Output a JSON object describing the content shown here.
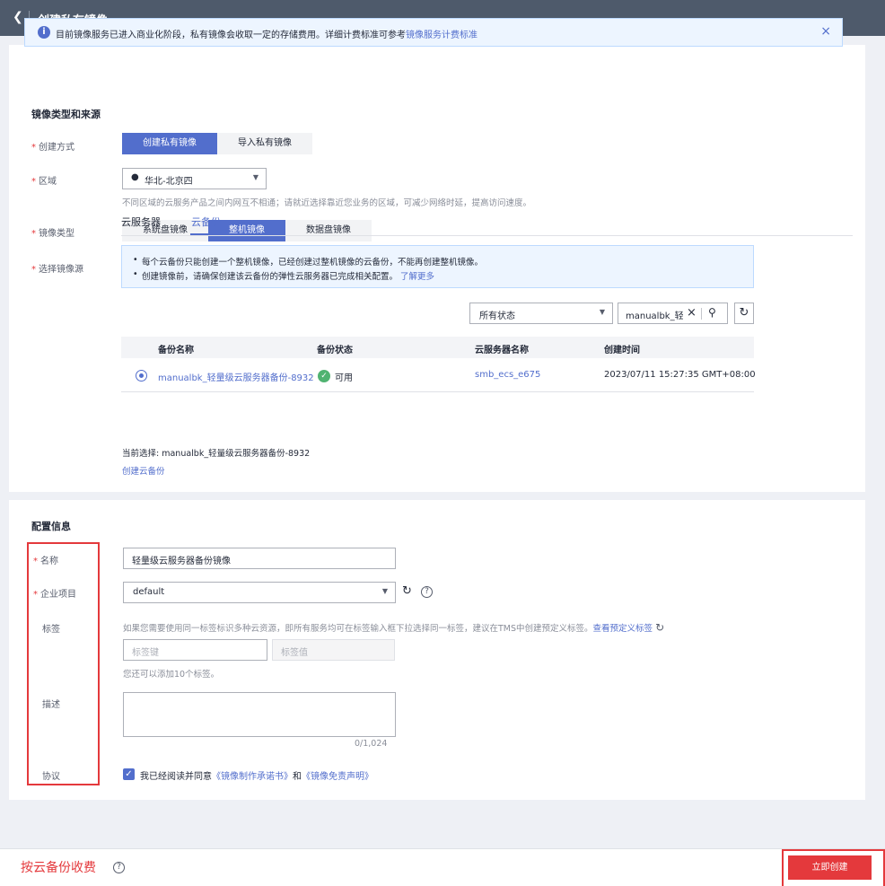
{
  "header": {
    "title": "创建私有镜像",
    "back_icon": "chevron-left-icon"
  },
  "notice": {
    "text": "目前镜像服务已进入商业化阶段，私有镜像会收取一定的存储费用。详细计费标准可参考",
    "link": "镜像服务计费标准",
    "close": "×"
  },
  "section1": {
    "title": "镜像类型和来源"
  },
  "create_method": {
    "label": "创建方式",
    "options": [
      "创建私有镜像",
      "导入私有镜像"
    ],
    "selected": "创建私有镜像"
  },
  "region": {
    "label": "区域",
    "value": "华北-北京四",
    "hint": "不同区域的云服务产品之间内网互不相通；请就近选择靠近您业务的区域，可减少网络时延，提高访问速度。"
  },
  "image_type": {
    "label": "镜像类型",
    "options": [
      "系统盘镜像",
      "整机镜像",
      "数据盘镜像"
    ],
    "selected": "整机镜像"
  },
  "image_source": {
    "label": "选择镜像源",
    "tabs": [
      "云服务器",
      "云备份"
    ],
    "active_tab": "云备份"
  },
  "tips": {
    "line1": "每个云备份只能创建一个整机镜像，已经创建过整机镜像的云备份，不能再创建整机镜像。",
    "line2": "创建镜像前，请确保创建该云备份的弹性云服务器已完成相关配置。",
    "line2_link": "了解更多"
  },
  "filter": {
    "status": "所有状态",
    "search_value": "manualbk_轻量级"
  },
  "table": {
    "headers": [
      "备份名称",
      "备份状态",
      "云服务器名称",
      "创建时间"
    ],
    "rows": [
      {
        "name": "manualbk_轻量级云服务器备份-8932",
        "status": "可用",
        "server": "smb_ecs_e675",
        "created": "2023/07/11 15:27:35 GMT+08:00"
      }
    ]
  },
  "current_selection": "当前选择: manualbk_轻量级云服务器备份-8932",
  "create_backup_link": "创建云备份",
  "section2": {
    "title": "配置信息"
  },
  "name_field": {
    "label": "名称",
    "value": "轻量级云服务器备份镜像"
  },
  "project": {
    "label": "企业项目",
    "value": "default"
  },
  "tags": {
    "label": "标签",
    "hint": "如果您需要使用同一标签标识多种云资源，即所有服务均可在标签输入框下拉选择同一标签，建议在TMS中创建预定义标签。",
    "hint_link": "查看预定义标签",
    "key_placeholder": "标签键",
    "value_placeholder": "标签值",
    "remaining": "您还可以添加10个标签。"
  },
  "description": {
    "label": "描述",
    "counter": "0/1,024"
  },
  "agreement": {
    "label": "协议",
    "prefix": "我已经阅读并同意",
    "link1": "《镜像制作承诺书》",
    "middle": "和",
    "link2": "《镜像免责声明》"
  },
  "footer": {
    "fee": "按云备份收费",
    "create_button": "立即创建"
  }
}
